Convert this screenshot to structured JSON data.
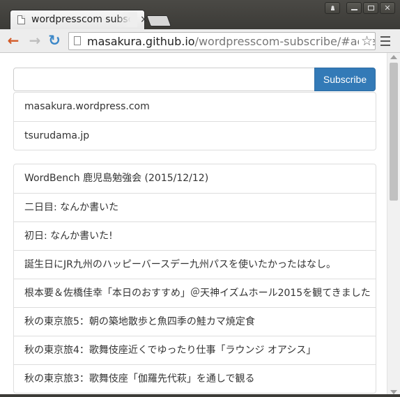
{
  "browser": {
    "tab_title": "wordpresscom subscribe",
    "tab_close": "×",
    "url_host": "masakura.github.io",
    "url_path": "/wordpresscom-subscribe/#access_t"
  },
  "subscribe": {
    "input_value": "",
    "button_label": "Subscribe"
  },
  "sites": [
    "masakura.wordpress.com",
    "tsurudama.jp"
  ],
  "posts": [
    "WordBench 鹿児島勉強会 (2015/12/12)",
    "二日目: なんか書いた",
    "初日: なんか書いた!",
    "誕生日にJR九州のハッピーバースデー九州パスを使いたかったはなし。",
    "根本要＆佐橋佳幸「本日のおすすめ」＠天神イズムホール2015を観てきました",
    "秋の東京旅5：朝の築地散歩と魚四季の鮭カマ焼定食",
    "秋の東京旅4：歌舞伎座近くでゆったり仕事「ラウンジ オアシス」",
    "秋の東京旅3：歌舞伎座「伽羅先代萩」を通しで観る"
  ],
  "colors": {
    "accent": "#337ab7",
    "back_arrow": "#d35a27",
    "reload": "#3b87c8"
  },
  "icons": {
    "back": "back-arrow-icon",
    "forward": "forward-arrow-icon",
    "reload": "reload-icon",
    "bookmark": "star-icon",
    "menu": "hamburger-menu-icon"
  }
}
